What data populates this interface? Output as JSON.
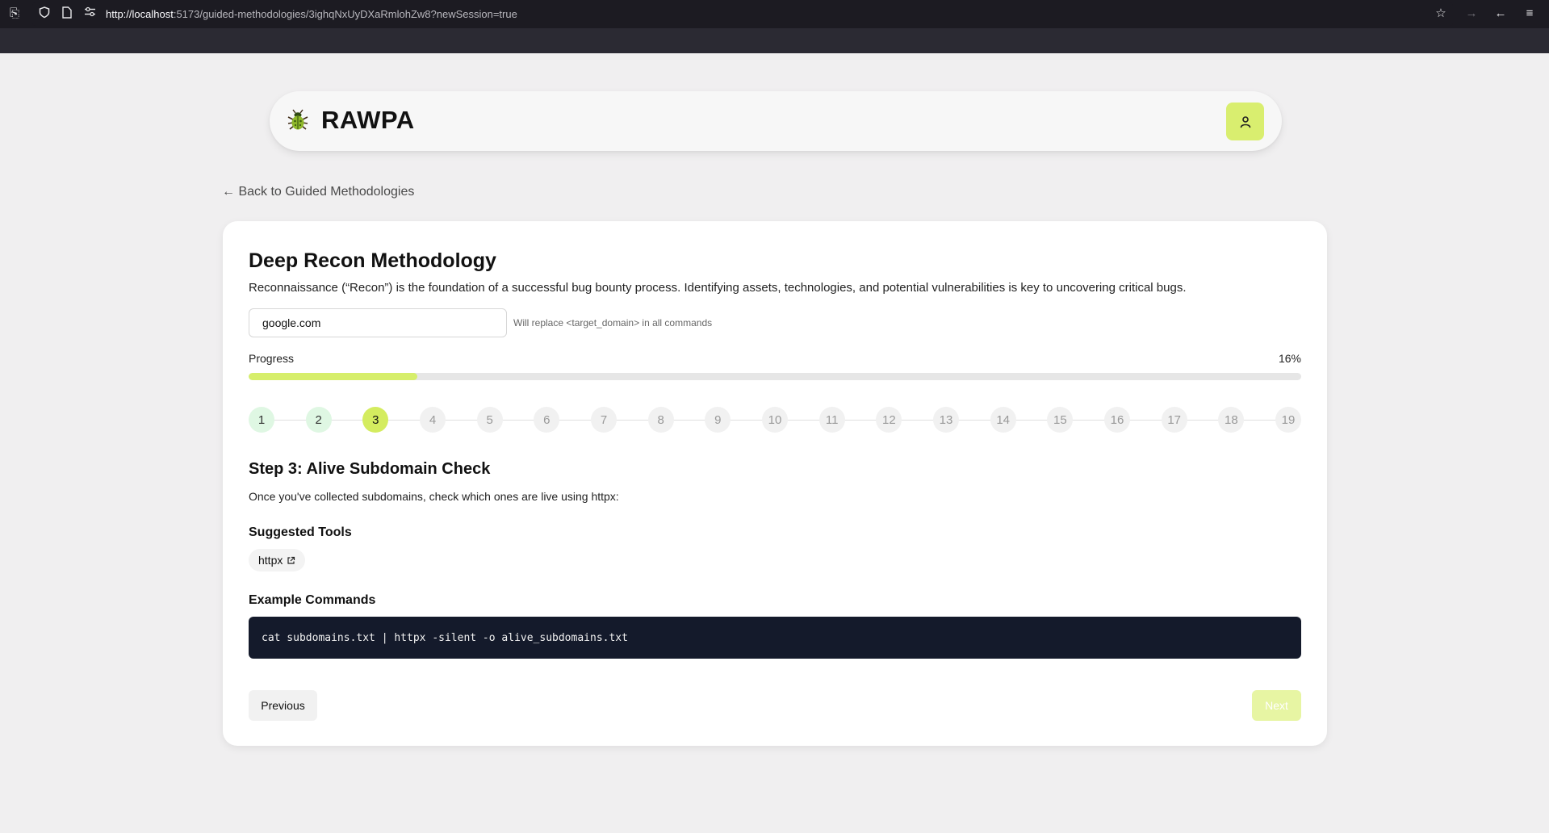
{
  "browser": {
    "url_host": "http://localhost",
    "url_rest": ":5173/guided-methodologies/3ighqNxUyDXaRmlohZw8?newSession=true"
  },
  "header": {
    "logo_text": "RAWPA",
    "logo_icon": "bug-icon",
    "user_icon": "user-icon"
  },
  "back_link": "← Back to Guided Methodologies",
  "methodology": {
    "title": "Deep Recon Methodology",
    "description": "Reconnaissance (“Recon”) is the foundation of a successful bug bounty process. Identifying assets, technologies, and potential vulnerabilities is key to uncovering critical bugs.",
    "domain_value": "google.com",
    "domain_hint": "Will replace <target_domain> in all commands",
    "progress_label": "Progress",
    "progress_text": "16%",
    "progress_value": 0.16
  },
  "steps": [
    "1",
    "2",
    "3",
    "4",
    "5",
    "6",
    "7",
    "8",
    "9",
    "10",
    "11",
    "12",
    "13",
    "14",
    "15",
    "16",
    "17",
    "18",
    "19"
  ],
  "current_step": 3,
  "step": {
    "title": "Step 3: Alive Subdomain Check",
    "description": "Once you've collected subdomains, check which ones are live using httpx:",
    "tools_heading": "Suggested Tools",
    "tools": [
      "httpx"
    ],
    "commands_heading": "Example Commands",
    "command": "cat subdomains.txt | httpx -silent -o alive_subdomains.txt"
  },
  "buttons": {
    "previous": "Previous",
    "next": "Next"
  },
  "colors": {
    "accent": "#d4ec5f",
    "code_bg": "#141a2b",
    "completed_step": "#dff7e3"
  }
}
